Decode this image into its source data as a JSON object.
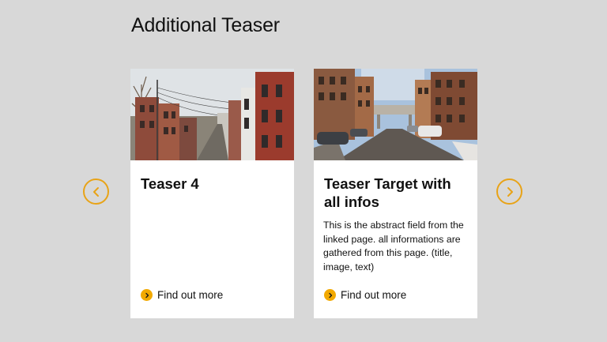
{
  "section": {
    "title": "Additional Teaser"
  },
  "carousel": {
    "prev_icon": "chevron-left-icon",
    "next_icon": "chevron-right-icon",
    "accent_color": "#e8a317"
  },
  "cards": [
    {
      "title": "Teaser 4",
      "abstract": "",
      "link_label": "Find out more",
      "image": "street-houses-photo"
    },
    {
      "title": "Teaser Target with all infos",
      "abstract": "This is the abstract field from the linked page. all informations are gathered from this page. (title, image, text)",
      "link_label": "Find out more",
      "image": "city-street-photo"
    }
  ],
  "colors": {
    "background": "#d8d8d8",
    "card": "#ffffff",
    "link_icon": "#f2a900"
  }
}
